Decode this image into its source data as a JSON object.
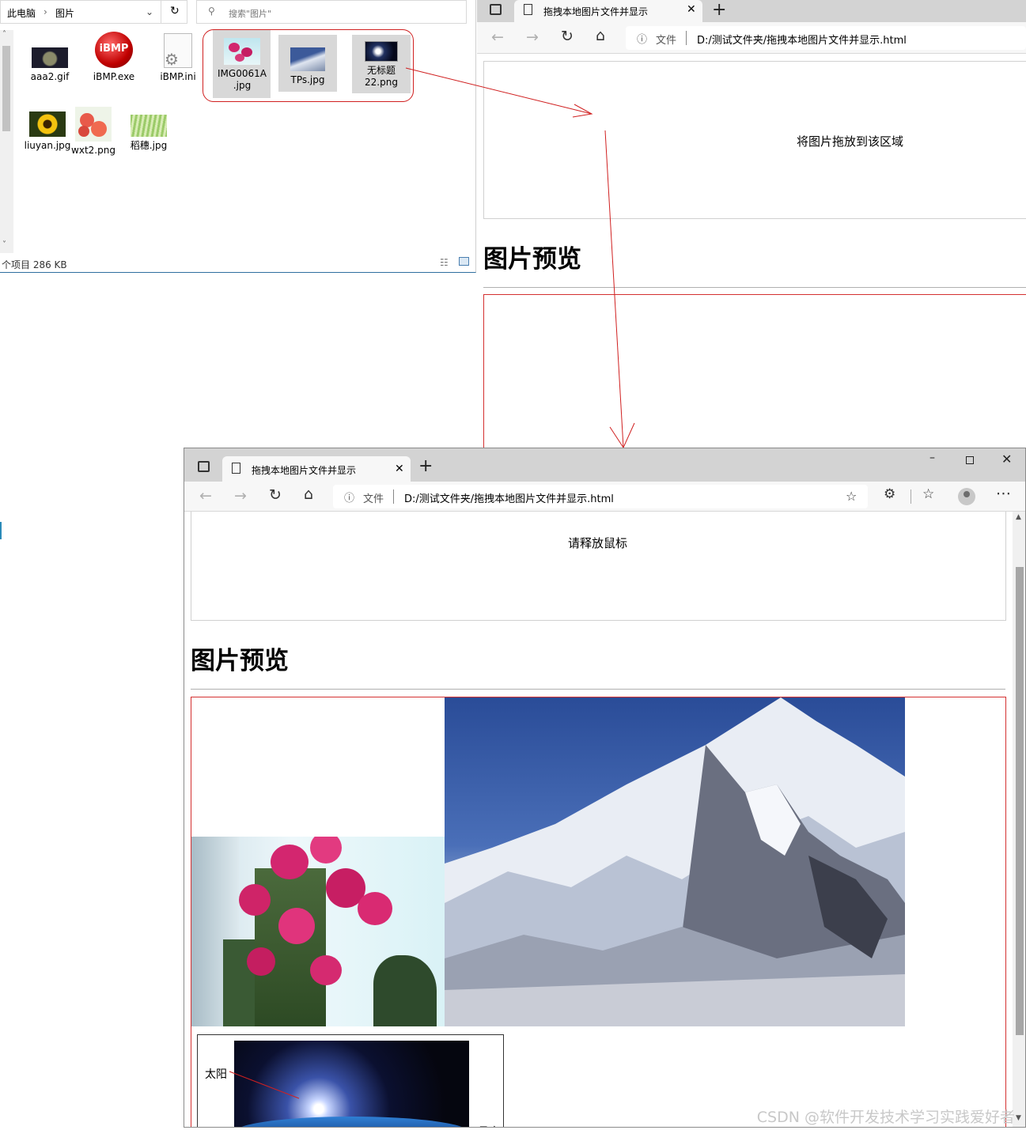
{
  "explorer": {
    "breadcrumb": [
      "此电脑",
      "图片"
    ],
    "search_placeholder": "搜索\"图片\"",
    "status": "个项目   286 KB",
    "files": [
      {
        "name": "aaa2.gif",
        "icon": "galaxy-thumbnail"
      },
      {
        "name": "iBMP.exe",
        "icon": "ibmp-app-icon"
      },
      {
        "name": "iBMP.ini",
        "icon": "settings-file-icon"
      },
      {
        "name": "IMG0061A .jpg",
        "icon": "orchid-thumbnail",
        "selected": true
      },
      {
        "name": "TPs.jpg",
        "icon": "mountain-thumbnail",
        "selected": true
      },
      {
        "name": "无标题 22.png",
        "icon": "earth-thumbnail",
        "selected": true
      },
      {
        "name": "liuyan.jpg",
        "icon": "sunflower-thumbnail"
      },
      {
        "name": "wxt2.png",
        "icon": "peach-thumbnail"
      },
      {
        "name": "稻穗.jpg",
        "icon": "rice-thumbnail"
      }
    ]
  },
  "browser_back": {
    "tab_title": "拖拽本地图片文件并显示",
    "address_prefix": "文件",
    "address": "D:/测试文件夹/拖拽本地图片文件并显示.html",
    "dropzone_text": "将图片拖放到该区域",
    "heading": "图片预览"
  },
  "browser_front": {
    "tab_title": "拖拽本地图片文件并显示",
    "address_prefix": "文件",
    "address": "D:/测试文件夹/拖拽本地图片文件并显示.html",
    "dropzone_text": "请释放鼠标",
    "heading": "图片预览",
    "annotation_label": "太阳",
    "annotation_right": "月亮"
  },
  "watermark": "CSDN @软件开发技术学习实践爱好者",
  "colors": {
    "annotation_red": "#d02020",
    "chrome_gray": "#d3d3d3",
    "toolbar_bg": "#f7f7f7"
  }
}
